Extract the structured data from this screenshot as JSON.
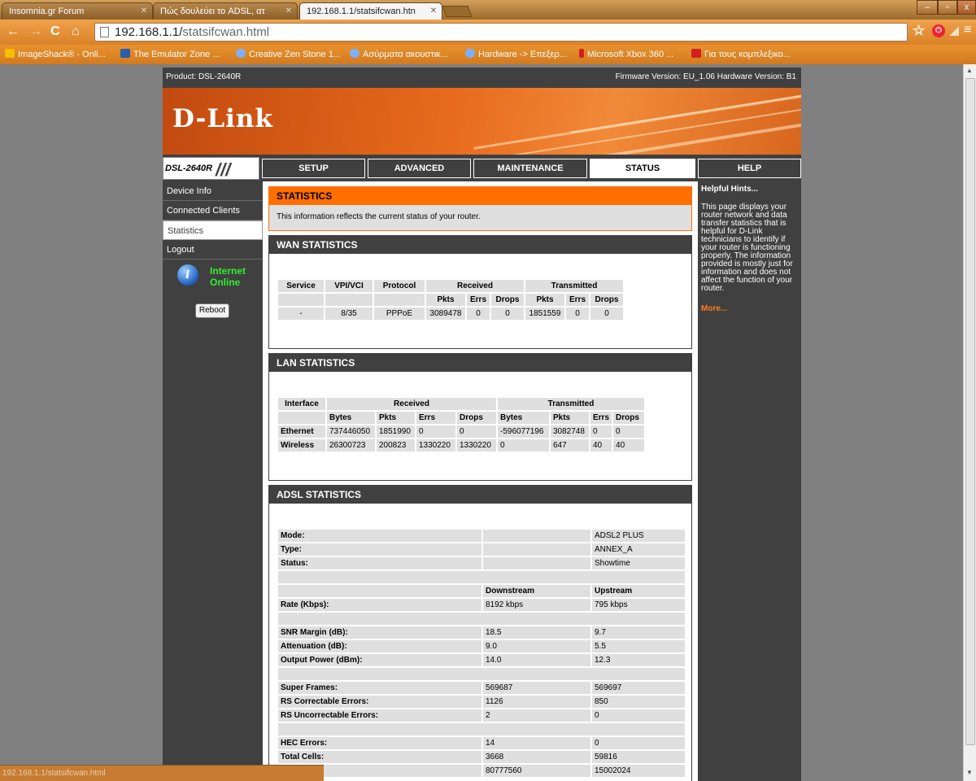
{
  "browser": {
    "tabs": [
      {
        "title": "Insomnia.gr Forum"
      },
      {
        "title": "Πώς δουλεύει το ADSL, ατ"
      },
      {
        "title": "192.168.1.1/statsifcwan.htn"
      }
    ],
    "url_host": "192.168.1.1/",
    "url_path": "statsifcwan.html",
    "bookmarks": [
      "ImageShack® - Onli...",
      "The Emulator Zone ...",
      "Creative Zen Stone 1...",
      "Ασύρματα ακουστικ...",
      "Hardware -> Επεξερ...",
      "Microsoft Xbox 360 ...",
      "Για τους κομπλεξικο..."
    ],
    "status_url": "192.168.1.1/statsifcwan.html"
  },
  "router": {
    "product": "Product: DSL-2640R",
    "firmware": "Firmware Version: EU_1.06 Hardware Version: B1",
    "logo": "D-Link",
    "model": "DSL-2640R",
    "nav": [
      "SETUP",
      "ADVANCED",
      "MAINTENANCE",
      "STATUS",
      "HELP"
    ],
    "sidebar": [
      "Device Info",
      "Connected Clients",
      "Statistics",
      "Logout"
    ],
    "status_line1": "Internet",
    "status_line2": "Online",
    "reboot": "Reboot"
  },
  "stats": {
    "title": "STATISTICS",
    "desc": "This information reflects the current status of your router."
  },
  "wan": {
    "title": "WAN STATISTICS",
    "h_service": "Service",
    "h_vpivci": "VPI/VCI",
    "h_protocol": "Protocol",
    "h_received": "Received",
    "h_transmitted": "Transmitted",
    "h_pkts": "Pkts",
    "h_errs": "Errs",
    "h_drops": "Drops",
    "row": {
      "service": "-",
      "vpivci": "8/35",
      "protocol": "PPPoE",
      "rx_pkts": "3089478",
      "rx_errs": "0",
      "rx_drops": "0",
      "tx_pkts": "1851559",
      "tx_errs": "0",
      "tx_drops": "0"
    }
  },
  "lan": {
    "title": "LAN STATISTICS",
    "h_interface": "Interface",
    "h_received": "Received",
    "h_transmitted": "Transmitted",
    "h_bytes": "Bytes",
    "h_pkts": "Pkts",
    "h_errs": "Errs",
    "h_drops": "Drops",
    "rows": [
      {
        "name": "Ethernet",
        "rx_bytes": "737446050",
        "rx_pkts": "1851990",
        "rx_errs": "0",
        "rx_drops": "0",
        "tx_bytes": "-596077196",
        "tx_pkts": "3082748",
        "tx_errs": "0",
        "tx_drops": "0"
      },
      {
        "name": "Wireless",
        "rx_bytes": "26300723",
        "rx_pkts": "200823",
        "rx_errs": "1330220",
        "rx_drops": "1330220",
        "tx_bytes": "0",
        "tx_pkts": "647",
        "tx_errs": "40",
        "tx_drops": "40"
      }
    ]
  },
  "adsl": {
    "title": "ADSL STATISTICS",
    "mode_label": "Mode:",
    "mode": "ADSL2 PLUS",
    "type_label": "Type:",
    "type": "ANNEX_A",
    "status_label": "Status:",
    "status": "Showtime",
    "downstream": "Downstream",
    "upstream": "Upstream",
    "rows1": [
      {
        "label": "Rate (Kbps):",
        "down": "8192 kbps",
        "up": "795 kbps"
      }
    ],
    "rows2": [
      {
        "label": "SNR Margin (dB):",
        "down": "18.5",
        "up": "9.7"
      },
      {
        "label": "Attenuation (dB):",
        "down": "9.0",
        "up": "5.5"
      },
      {
        "label": "Output Power (dBm):",
        "down": "14.0",
        "up": "12.3"
      }
    ],
    "rows3": [
      {
        "label": "Super Frames:",
        "down": "569687",
        "up": "569697"
      },
      {
        "label": "RS Correctable Errors:",
        "down": "1126",
        "up": "850"
      },
      {
        "label": "RS Uncorrectable Errors:",
        "down": "2",
        "up": "0"
      }
    ],
    "rows4": [
      {
        "label": "HEC Errors:",
        "down": "14",
        "up": "0"
      },
      {
        "label": "Total Cells:",
        "down": "3668",
        "up": "59816"
      },
      {
        "label": "",
        "down": "80777560",
        "up": "15002024"
      }
    ]
  }
}
